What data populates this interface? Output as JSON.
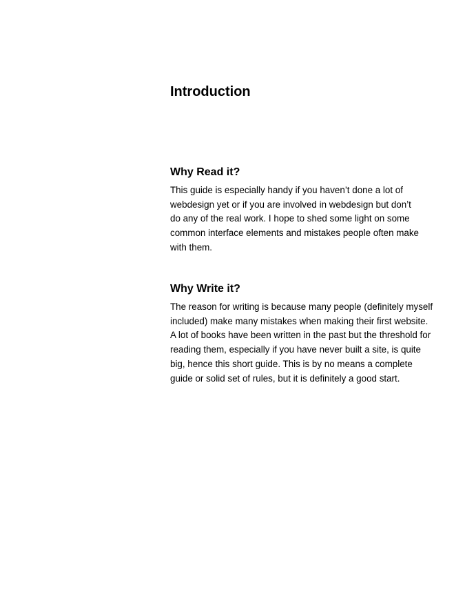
{
  "page": {
    "title": "Introduction",
    "sections": [
      {
        "heading": "Why Read it?",
        "lines": [
          "This guide is especially handy if you haven’t done a lot of",
          "webdesign yet or if you are involved in webdesign but don’t",
          "do any of the real work. I hope to shed some light on some",
          "common interface elements and mistakes people often make",
          "with them."
        ]
      },
      {
        "heading": "Why Write it?",
        "lines": [
          "The reason for writing is because many people (definitely myself",
          "included) make many mistakes when making their first website.",
          "A lot of books have been written in the past but the threshold for",
          "reading them, especially if you have never built a site, is quite",
          "big, hence this short guide. This is by no means a complete",
          "guide or solid set of rules, but it is definitely a good start."
        ]
      }
    ]
  }
}
